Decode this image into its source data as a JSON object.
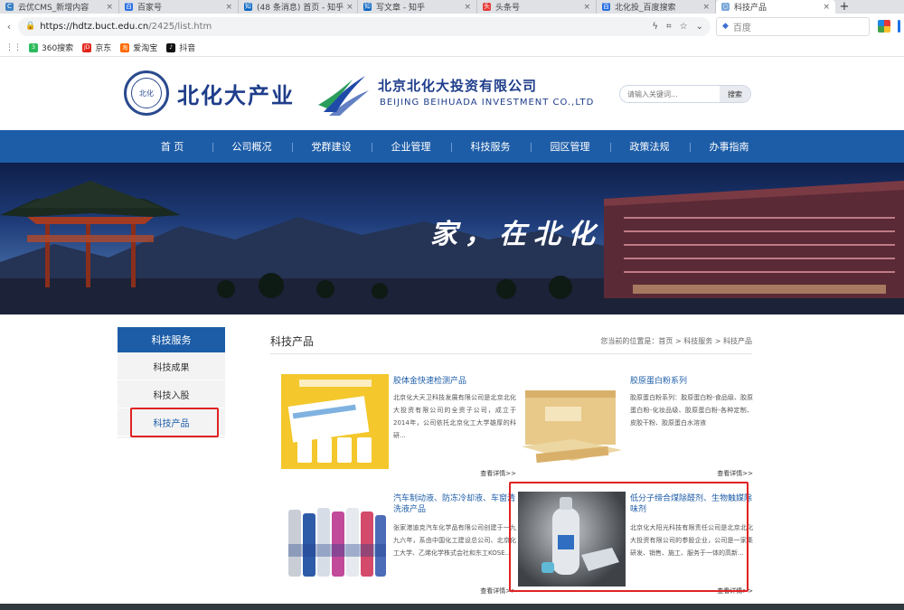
{
  "browser": {
    "tabs": [
      {
        "title": "云优CMS_新增内容",
        "fav_color": "#3b82c4",
        "fav": "C"
      },
      {
        "title": "百家号",
        "fav_color": "#2b6fe0",
        "fav": "百"
      },
      {
        "title": "(48 条消息) 首页 - 知乎",
        "fav_color": "#0a66c2",
        "fav": "知"
      },
      {
        "title": "写文章 - 知乎",
        "fav_color": "#0a66c2",
        "fav": "知"
      },
      {
        "title": "头条号",
        "fav_color": "#e53935",
        "fav": "头"
      },
      {
        "title": "北化投_百度搜索",
        "fav_color": "#2b6fe0",
        "fav": "百"
      },
      {
        "title": "科技产品",
        "fav_color": "#7aa7d8",
        "fav": "○",
        "active": true
      }
    ],
    "url_host": "https://hdtz.buct.edu.cn",
    "url_path": "/2425/list.htm",
    "search_engine": "百度",
    "bookmarks": [
      {
        "label": "360搜索",
        "color": "#2dbb5c",
        "icon": "3"
      },
      {
        "label": "京东",
        "color": "#e1251b",
        "icon": "JD"
      },
      {
        "label": "爱淘宝",
        "color": "#ff6a00",
        "icon": "淘"
      },
      {
        "label": "抖音",
        "color": "#111111",
        "icon": "♪"
      }
    ]
  },
  "header": {
    "logo_text": "北化大产业",
    "company_cn": "北京北化大投资有限公司",
    "company_en": "BEIJING BEIHUADA INVESTMENT CO.,LTD",
    "search_placeholder": "请输入关键词...",
    "search_button": "搜索"
  },
  "nav": {
    "items": [
      "首 页",
      "公司概况",
      "党群建设",
      "企业管理",
      "科技服务",
      "园区管理",
      "政策法规",
      "办事指南"
    ]
  },
  "banner": {
    "slogan": "家，在北化"
  },
  "sidebar": {
    "title": "科技服务",
    "items": [
      "科技成果",
      "科技入股",
      "科技产品"
    ]
  },
  "content": {
    "title": "科技产品",
    "breadcrumb": "您当前的位置是：首页 > 科技服务 > 科技产品",
    "more_label": "查看详情>>",
    "products": [
      {
        "title": "胶体金快速检测产品",
        "desc": "北京化大天卫科技发展有限公司是北京北化大投资有限公司的全资子公司，成立于2014年，公司依托北京化工大学雄厚的科研..."
      },
      {
        "title": "胶原蛋白粉系列",
        "desc": "胶原蛋白粉系列：胶原蛋白粉-食品级、胶原蛋白粉-化妆品级、胶原蛋白粉-各种定制、皮胶干粉、胶原蛋白水溶液"
      },
      {
        "title": "汽车制动液、防冻冷却液、车窗清洗液产品",
        "desc": "张家港迪克汽车化学品有限公司创建于一九九六年，系由中国化工建设总公司、北京化工大学、乙烯化学株式会社和东工KOSE..."
      },
      {
        "title": "低分子缔合煤除醛剂、生物触媒除味剂",
        "desc": "北京化大阳光科技有限责任公司是北京北化大投资有限公司的参股企业，公司是一家集研发、销售、施工、服务于一体的高新..."
      }
    ]
  }
}
